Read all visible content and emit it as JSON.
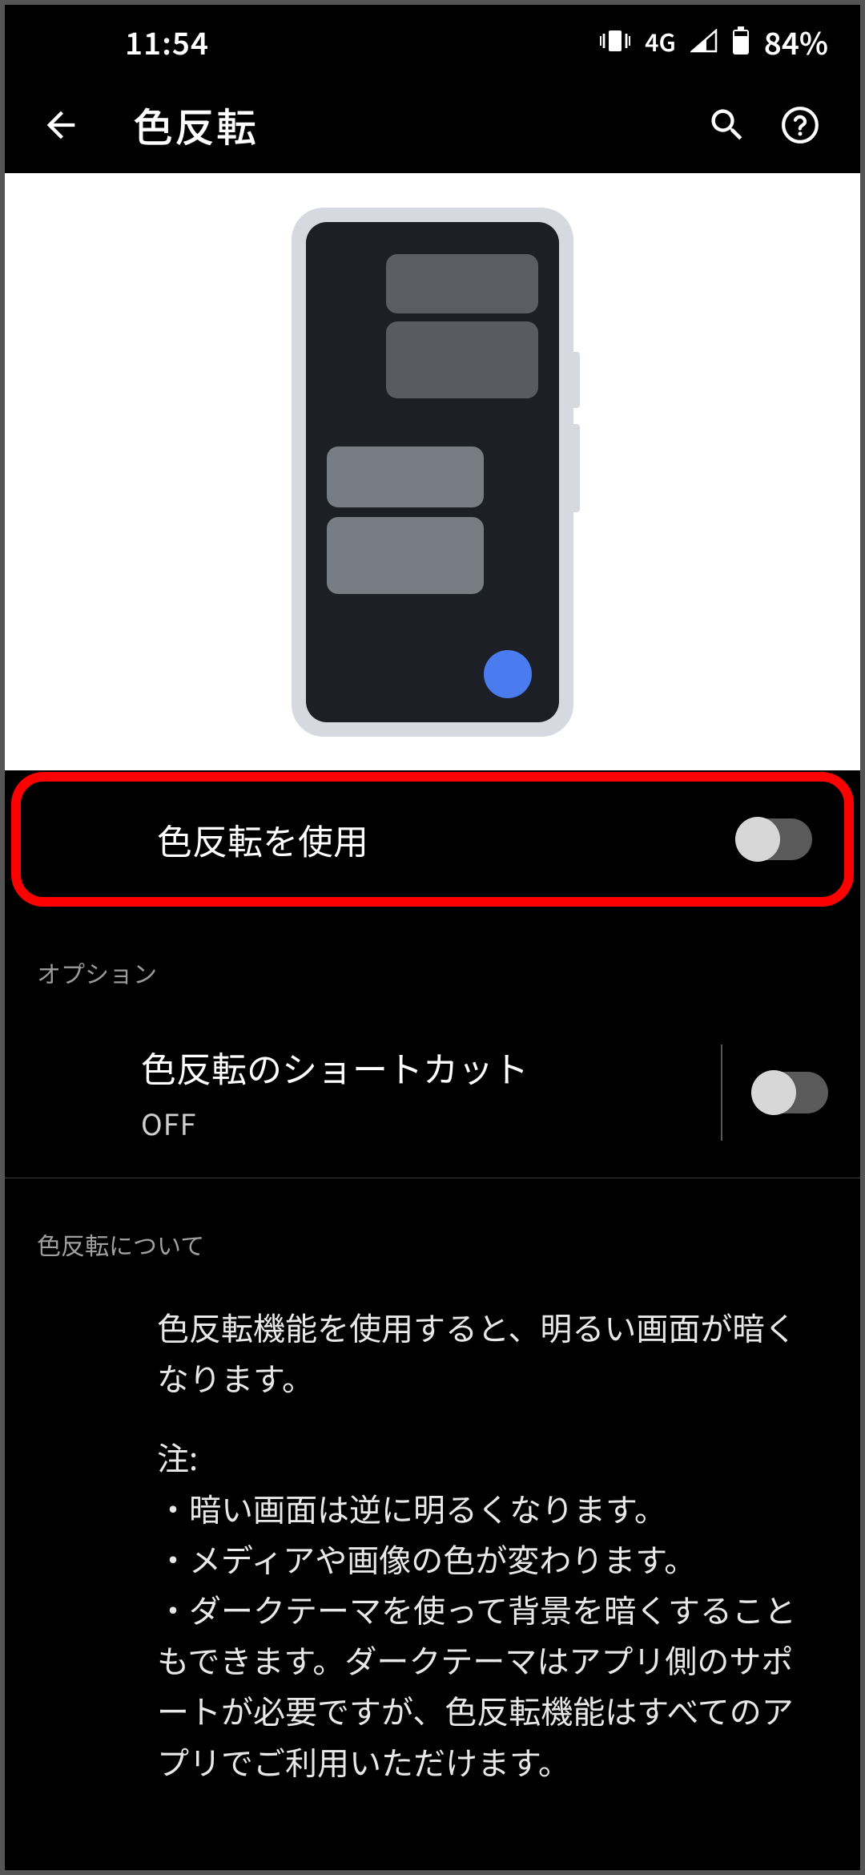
{
  "statusbar": {
    "time": "11:54",
    "network": "4G",
    "battery": "84%"
  },
  "appbar": {
    "title": "色反転"
  },
  "main_toggle": {
    "label": "色反転を使用",
    "enabled": false
  },
  "options_header": "オプション",
  "shortcut": {
    "label": "色反転のショートカット",
    "status": "OFF",
    "enabled": false
  },
  "about": {
    "header": "色反転について",
    "paragraph1": "色反転機能を使用すると、明るい画面が暗くなります。",
    "note_label": "注:",
    "bullet1": "・暗い画面は逆に明るくなります。",
    "bullet2": "・メディアや画像の色が変わります。",
    "bullet3": "・ダークテーマを使って背景を暗くすることもできます。ダークテーマはアプリ側のサポートが必要ですが、色反転機能はすべてのアプリでご利用いただけます。"
  },
  "highlight_color": "#ff0000"
}
